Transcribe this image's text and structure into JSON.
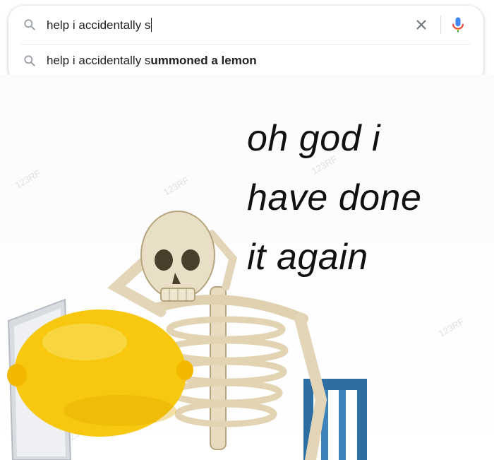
{
  "search": {
    "query": "help i accidentally s",
    "suggestion_prefix": "help i accidentally s",
    "suggestion_bold": "ummoned a lemon",
    "icons": {
      "search": "search-icon",
      "clear": "close-icon",
      "voice": "microphone-icon"
    },
    "colors": {
      "mic_blue": "#4285f4",
      "mic_red": "#ea4335",
      "mic_yellow": "#fbbc05",
      "mic_green": "#34a853"
    }
  },
  "meme": {
    "caption": "oh god i\nhave done\nit again",
    "lemon_color": "#f7c80f",
    "chair_color": "#2d6fa3"
  }
}
